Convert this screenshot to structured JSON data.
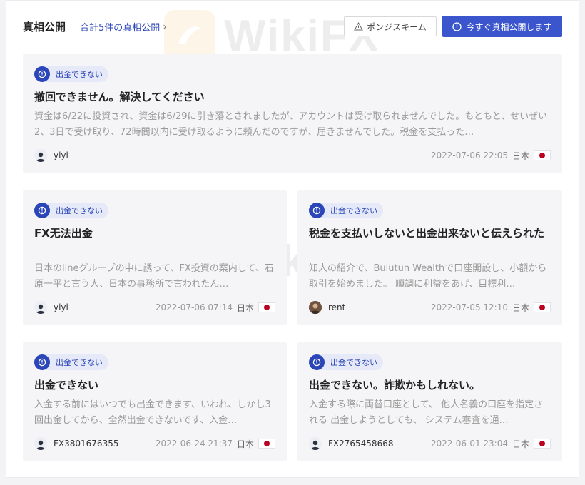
{
  "header": {
    "title": "真相公開",
    "count_link": "合計5件の真相公開",
    "ponzi_button": "ポンジスキーム",
    "expose_button": "今すぐ真相公開します"
  },
  "watermark": "WikiFX",
  "cards": [
    {
      "badge": "出金できない",
      "title": "撤回できません。解決してください",
      "body": "資金は6/22に投資され、資金は6/29に引き落とされましたが、アカウントは受け取られませんでした。もともと、せいぜい2、3日で受け取り、72時間以内に受け取るように頼んだのですが、届きませんでした。税金を支払った…",
      "user": "yiyi",
      "date": "2022-07-06 22:05",
      "country": "日本"
    },
    {
      "badge": "出金できない",
      "title": "FX无法出金",
      "body": "日本のlineグループの中に誘って、FX投資の案内して、石原一平と言う人、日本の事務所で言われたん…",
      "user": "yiyi",
      "date": "2022-07-06 07:14",
      "country": "日本"
    },
    {
      "badge": "出金できない",
      "title": "税金を支払いしないと出金出来ないと伝えられた",
      "body": "知人の紹介で、Bulutun Wealthで口座開設し、小額から取引を始めました。 順調に利益をあげ、目標利…",
      "user": "rent",
      "date": "2022-07-05 12:10",
      "country": "日本"
    },
    {
      "badge": "出金できない",
      "title": "出金できない",
      "body": "入金する前にはいつでも出金できます、いわれ、しかし3回出金してから、全然出金できないです、入金…",
      "user": "FX3801676355",
      "date": "2022-06-24 21:37",
      "country": "日本"
    },
    {
      "badge": "出金できない",
      "title": "出金できない。詐欺かもしれない。",
      "body": "入金する際に両替口座として、 他人名義の口座を指定される 出金しようとしても、 システム審査を通…",
      "user": "FX2765458668",
      "date": "2022-06-01 23:04",
      "country": "日本"
    }
  ]
}
